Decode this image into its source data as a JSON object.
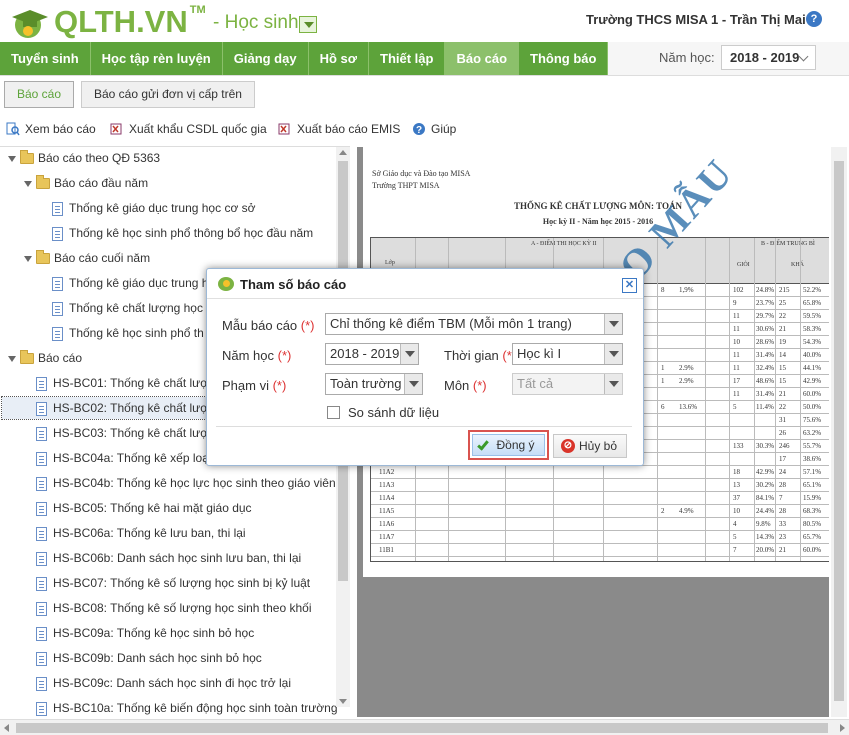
{
  "header": {
    "logo_text": "QLTH.VN",
    "logo_tm": "TM",
    "role": "- Học sinh",
    "user": "Trường THCS MISA 1 - Trần Thị Mai",
    "help_glyph": "?"
  },
  "nav": {
    "tabs": [
      "Tuyển sinh",
      "Học tập rèn luyện",
      "Giảng dạy",
      "Hồ sơ",
      "Thiết lập",
      "Báo cáo",
      "Thông báo"
    ],
    "active": "Báo cáo",
    "year_label": "Năm học:",
    "year_value": "2018 - 2019"
  },
  "subtabs": [
    "Báo cáo",
    "Báo cáo gửi đơn vị cấp trên"
  ],
  "toolbar": {
    "view": "Xem báo cáo",
    "export_csdl": "Xuất khẩu CSDL quốc gia",
    "export_emis": "Xuất báo cáo EMIS",
    "help": "Giúp"
  },
  "tree": {
    "n0": "Báo cáo theo QĐ 5363",
    "n1": "Báo cáo đầu năm",
    "n2": "Thống kê giáo dục trung học cơ sở",
    "n3": "Thống kê học sinh phổ thông bổ học đầu năm",
    "n4": "Báo cáo cuối năm",
    "n5": "Thống kê giáo dục trung h",
    "n6": "Thống kê chất lượng học",
    "n7": "Thống kê học sinh phổ th",
    "n8": "Báo cáo",
    "r1": "HS-BC01: Thống kê chất lượn",
    "r2": "HS-BC02: Thống kê chất lượn",
    "r3": "HS-BC03: Thống kê chất lượn",
    "r4": "HS-BC04a: Thống kê xếp loại",
    "r5": "HS-BC04b: Thống kê học lực học sinh theo giáo viên",
    "r6": "HS-BC05: Thống kê hai mặt giáo dục",
    "r7": "HS-BC06a: Thống kê lưu ban, thi lại",
    "r8": "HS-BC06b: Danh sách học sinh lưu ban, thi lại",
    "r9": "HS-BC07: Thống kê số lượng học sinh bị kỷ luật",
    "r10": "HS-BC08: Thống kê số lượng học sinh theo khối",
    "r11": "HS-BC09a: Thống kê học sinh bỏ học",
    "r12": "HS-BC09b: Danh sách học sinh bỏ học",
    "r13": "HS-BC09c: Danh sách học sinh đi học trở lại",
    "r14": "HS-BC10a: Thống kê biến động học sinh toàn trường"
  },
  "preview": {
    "line1": "Sở Giáo dục và Đào tạo MISA",
    "line2": "Trường THPT MISA",
    "title": "THỐNG KÊ CHẤT LƯỢNG MÔN: TOÁN",
    "subtitle": "Học kỳ II - Năm học 2015 - 2016",
    "head_a": "A - ĐIỂM THI HỌC KỲ II",
    "head_b": "B - ĐIỂM TRUNG BÌ",
    "col_lop": "Lớp",
    "col_gioi": "GIỎI",
    "col_kha": "KHÁ",
    "watermark": "BÁO CÁO MẪU",
    "rows": [
      {
        "c": "",
        "a": "8",
        "b": "1,9%",
        "g": "102",
        "gp": "24.8%",
        "k": "215",
        "kp": "52.2%"
      },
      {
        "c": "",
        "a": "",
        "b": "",
        "g": "9",
        "gp": "23.7%",
        "k": "25",
        "kp": "65.8%"
      },
      {
        "c": "",
        "a": "",
        "b": "",
        "g": "11",
        "gp": "29.7%",
        "k": "22",
        "kp": "59.5%"
      },
      {
        "c": "",
        "a": "",
        "b": "",
        "g": "11",
        "gp": "30.6%",
        "k": "21",
        "kp": "58.3%"
      },
      {
        "c": "",
        "a": "",
        "b": "",
        "g": "10",
        "gp": "28.6%",
        "k": "19",
        "kp": "54.3%"
      },
      {
        "c": "",
        "a": "",
        "b": "",
        "g": "11",
        "gp": "31.4%",
        "k": "14",
        "kp": "40.0%"
      },
      {
        "c": "",
        "a": "1",
        "b": "2.9%",
        "g": "11",
        "gp": "32.4%",
        "k": "15",
        "kp": "44.1%"
      },
      {
        "c": "",
        "a": "1",
        "b": "2.9%",
        "g": "17",
        "gp": "48.6%",
        "k": "15",
        "kp": "42.9%"
      },
      {
        "c": "",
        "a": "",
        "b": "",
        "g": "11",
        "gp": "31.4%",
        "k": "21",
        "kp": "60.0%"
      },
      {
        "c": "",
        "a": "6",
        "b": "13.6%",
        "g": "5",
        "gp": "11.4%",
        "k": "22",
        "kp": "50.0%"
      },
      {
        "c": "",
        "a": "",
        "b": "",
        "g": "",
        "gp": "",
        "k": "31",
        "kp": "75.6%"
      },
      {
        "c": "",
        "a": "",
        "b": "",
        "g": "",
        "gp": "",
        "k": "26",
        "kp": "63.2%"
      },
      {
        "c": "",
        "a": "",
        "b": "",
        "g": "133",
        "gp": "30.3%",
        "k": "246",
        "kp": "55.7%"
      },
      {
        "c": "",
        "a": "",
        "b": "",
        "g": "",
        "gp": "",
        "k": "17",
        "kp": "38.6%"
      },
      {
        "c": "11A2",
        "a": "",
        "b": "",
        "g": "18",
        "gp": "42.9%",
        "k": "24",
        "kp": "57.1%"
      },
      {
        "c": "11A3",
        "a": "",
        "b": "",
        "g": "13",
        "gp": "30.2%",
        "k": "28",
        "kp": "65.1%"
      },
      {
        "c": "11A4",
        "a": "",
        "b": "",
        "g": "37",
        "gp": "84.1%",
        "k": "7",
        "kp": "15.9%"
      },
      {
        "c": "11A5",
        "a": "2",
        "b": "4.9%",
        "g": "10",
        "gp": "24.4%",
        "k": "28",
        "kp": "68.3%"
      },
      {
        "c": "11A6",
        "a": "",
        "b": "",
        "g": "4",
        "gp": "9.8%",
        "k": "33",
        "kp": "80.5%"
      },
      {
        "c": "11A7",
        "a": "",
        "b": "",
        "g": "5",
        "gp": "14.3%",
        "k": "23",
        "kp": "65.7%"
      },
      {
        "c": "11B1",
        "a": "",
        "b": "",
        "g": "7",
        "gp": "20.0%",
        "k": "21",
        "kp": "60.0%"
      }
    ]
  },
  "dialog": {
    "title": "Tham số báo cáo",
    "close_glyph": "✕",
    "required_mark": "(*)",
    "template_label": "Mẫu báo cáo",
    "template_value": "Chỉ thống kê điểm TBM (Mỗi môn 1 trang)",
    "year_label": "Năm học",
    "year_value": "2018 - 2019",
    "period_label": "Thời gian",
    "period_value": "Học kì I",
    "scope_label": "Phạm vi",
    "scope_value": "Toàn trường",
    "subject_label": "Môn",
    "subject_value": "Tất cả",
    "compare_label": "So sánh dữ liệu",
    "compare_checked": false,
    "ok": "Đồng ý",
    "cancel": "Hủy bỏ"
  }
}
